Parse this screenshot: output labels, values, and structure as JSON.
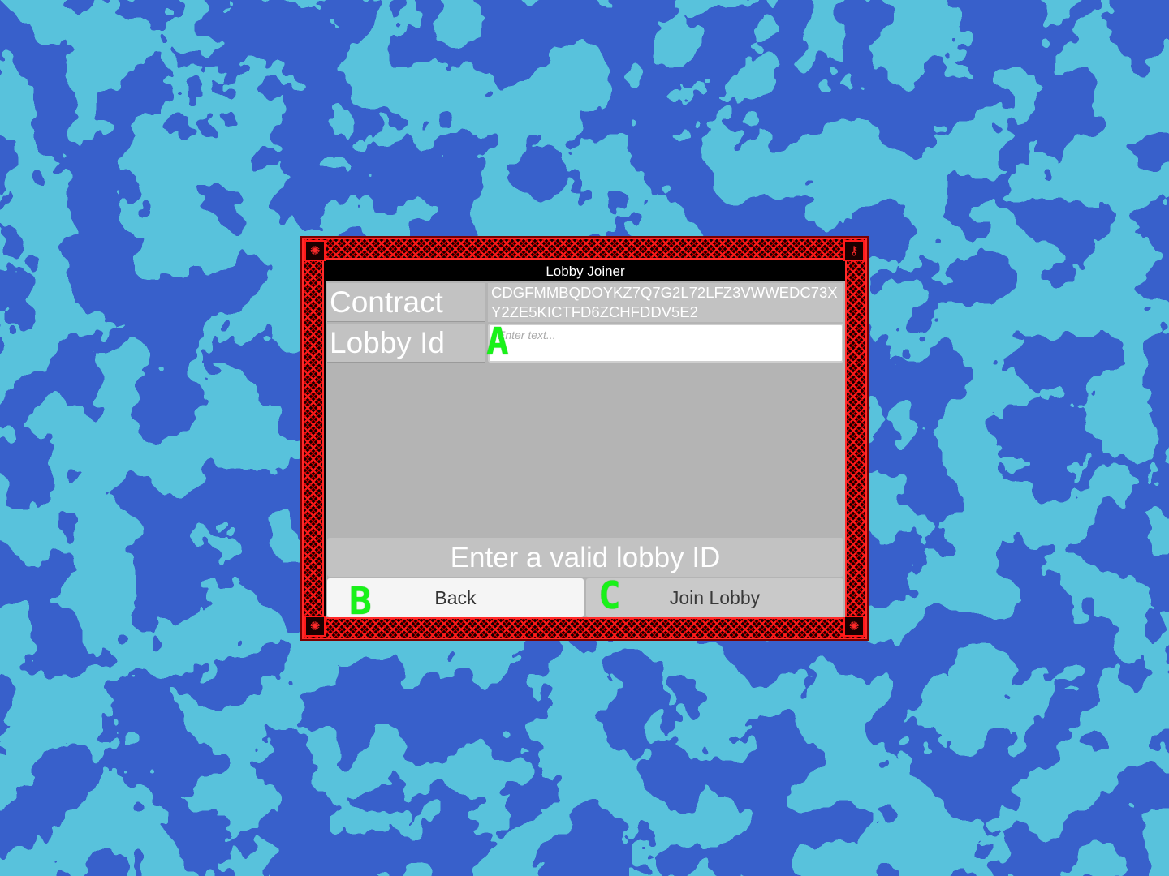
{
  "colors": {
    "background_dark": "#0a1f9a",
    "background_light": "#1a8ab8",
    "frame_red": "#ff1a1a",
    "marker_green": "#19f219",
    "panel_gray": "#b4b4b4"
  },
  "dialog": {
    "title": "Lobby Joiner",
    "contract": {
      "label": "Contract",
      "value": "CDGFMMBQDOYKZ7Q7G2L72LFZ3VWWEDC73XY2ZE5KICTFD6ZCHFDDV5E2"
    },
    "lobby_id": {
      "label": "Lobby Id",
      "value": "",
      "placeholder": "Enter text..."
    },
    "status": "Enter a valid lobby ID",
    "buttons": {
      "back": "Back",
      "join": "Join Lobby"
    }
  },
  "markers": {
    "a": "A",
    "b": "B",
    "c": "C"
  },
  "icons": {
    "corner_top_left": "ornament-icon",
    "corner_top_right": "key-icon",
    "corner_bottom_left": "ornament-icon",
    "corner_bottom_right": "ornament-icon"
  }
}
